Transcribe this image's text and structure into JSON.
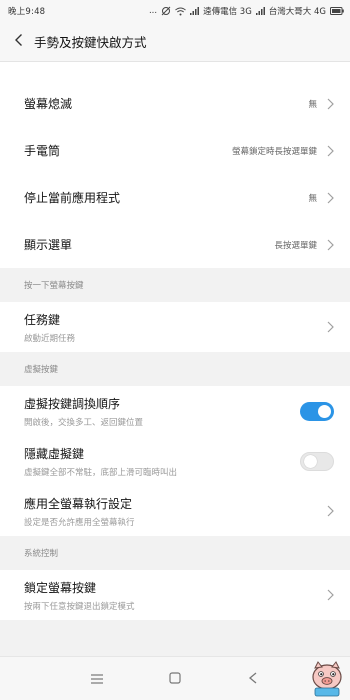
{
  "status_bar": {
    "time": "晚上9:48",
    "dots": "...",
    "carrier1": "遠傳電信 3G",
    "carrier2": "台灣大哥大 4G",
    "icons": [
      "mute-icon",
      "wifi-icon",
      "signal-icon",
      "signal-icon",
      "battery-icon"
    ]
  },
  "header": {
    "title": "手勢及按鍵快啟方式"
  },
  "group1": {
    "items": [
      {
        "label": "螢幕熄滅",
        "value": "無"
      },
      {
        "label": "手電筒",
        "value": "螢幕鎖定時長按選單鍵"
      },
      {
        "label": "停止當前應用程式",
        "value": "無"
      },
      {
        "label": "顯示選單",
        "value": "長按選單鍵"
      }
    ]
  },
  "section_tap_once": {
    "header": "按一下螢幕按鍵",
    "items": [
      {
        "label": "任務鍵",
        "sub": "啟動近期任務"
      }
    ]
  },
  "section_virtual": {
    "header": "虛擬按鍵",
    "items": [
      {
        "label": "虛擬按鍵調換順序",
        "sub": "開啟後，交換多工、返回鍵位置",
        "toggle": true
      },
      {
        "label": "隱藏虛擬鍵",
        "sub": "虛擬鍵全部不常駐，底部上滑可臨時叫出",
        "toggle": false
      },
      {
        "label": "應用全螢幕執行設定",
        "sub": "設定是否允許應用全螢幕執行"
      }
    ]
  },
  "section_system": {
    "header": "系統控制",
    "items": [
      {
        "label": "鎖定螢幕按鍵",
        "sub": "按兩下任意按鍵退出鎖定模式"
      }
    ]
  },
  "nav": {
    "icons": [
      "menu-icon",
      "home-icon",
      "back-icon"
    ]
  },
  "colors": {
    "accent": "#2b94e6",
    "background": "#f2f2f2",
    "card": "#ffffff"
  }
}
